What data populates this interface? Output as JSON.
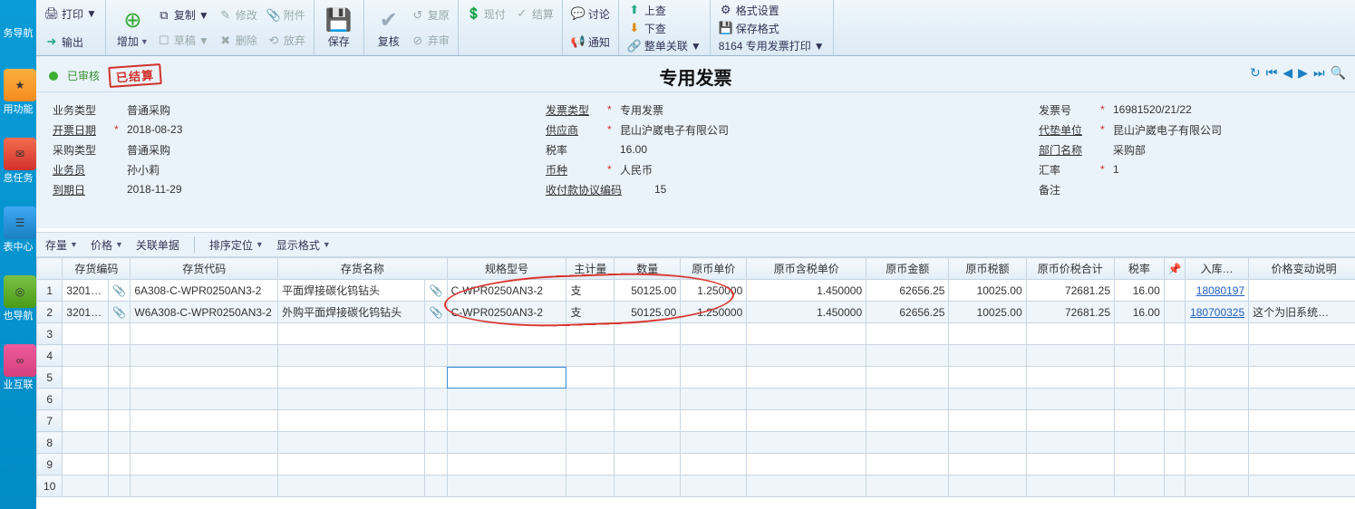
{
  "leftnav": {
    "items": [
      "务导航",
      "用功能",
      "息任务",
      "表中心",
      "也导航",
      "业互联"
    ]
  },
  "ribbon": {
    "print": "打印",
    "output": "输出",
    "add": "增加",
    "copy": "复制",
    "draft": "草稿",
    "modify": "修改",
    "delete": "删除",
    "attach": "附件",
    "abandon": "放弃",
    "save": "保存",
    "audit": "复核",
    "restore": "复原",
    "discard": "弃审",
    "cash": "现付",
    "settle": "结算",
    "discuss": "讨论",
    "notify": "通知",
    "up": "上查",
    "down": "下查",
    "rel": "整单关联",
    "fmt": "格式设置",
    "savefmt": "保存格式",
    "printfmt": "8164 专用发票打印"
  },
  "status": {
    "audited": "已审核",
    "stamp": "已结算"
  },
  "title": "专用发票",
  "header": {
    "col1": {
      "f1_l": "业务类型",
      "f1_v": "普通采购",
      "f2_l": "开票日期",
      "f2_v": "2018-08-23",
      "f3_l": "采购类型",
      "f3_v": "普通采购",
      "f4_l": "业务员",
      "f4_v": "孙小莉",
      "f5_l": "到期日",
      "f5_v": "2018-11-29"
    },
    "col2": {
      "f1_l": "发票类型",
      "f1_v": "专用发票",
      "f2_l": "供应商",
      "f2_v": "昆山沪崴电子有限公司",
      "f3_l": "税率",
      "f3_v": "16.00",
      "f4_l": "币种",
      "f4_v": "人民币",
      "f5_l": "收付款协议编码",
      "f5_v": "15"
    },
    "col3": {
      "f1_l": "发票号",
      "f1_v": "16981520/21/22",
      "f2_l": "代垫单位",
      "f2_v": "昆山沪崴电子有限公司",
      "f3_l": "部门名称",
      "f3_v": "采购部",
      "f4_l": "汇率",
      "f4_v": "1",
      "f5_l": "备注",
      "f5_v": ""
    }
  },
  "gridbar": {
    "stock": "存量",
    "price": "价格",
    "rel": "关联单据",
    "sort": "排序定位",
    "fmt": "显示格式"
  },
  "columns": {
    "c1": "存货编码",
    "c2": "存货代码",
    "c3": "存货名称",
    "c4": "规格型号",
    "c5": "主计量",
    "c6": "数量",
    "c7": "原币单价",
    "c8": "原币含税单价",
    "c9": "原币金额",
    "c10": "原币税额",
    "c11": "原币价税合计",
    "c12": "税率",
    "c13": "入库…",
    "c14": "价格变动说明"
  },
  "rows": [
    {
      "code": "3201…",
      "alias": "6A308-C-WPR0250AN3-2",
      "name": "平面焊接碳化钨钻头",
      "spec": "C-WPR0250AN3-2",
      "uom": "支",
      "qty": "50125.00",
      "price": "1.250000",
      "taxprice": "1.450000",
      "amount": "62656.25",
      "tax": "10025.00",
      "total": "72681.25",
      "rate": "16.00",
      "ref": "18080197",
      "note": ""
    },
    {
      "code": "3201…",
      "alias": "W6A308-C-WPR0250AN3-2",
      "name": "外购平面焊接碳化钨钻头",
      "spec": "C-WPR0250AN3-2",
      "uom": "支",
      "qty": "50125.00",
      "price": "1.250000",
      "taxprice": "1.450000",
      "amount": "62656.25",
      "tax": "10025.00",
      "total": "72681.25",
      "rate": "16.00",
      "ref": "180700325",
      "note": "这个为旧系统…"
    }
  ]
}
